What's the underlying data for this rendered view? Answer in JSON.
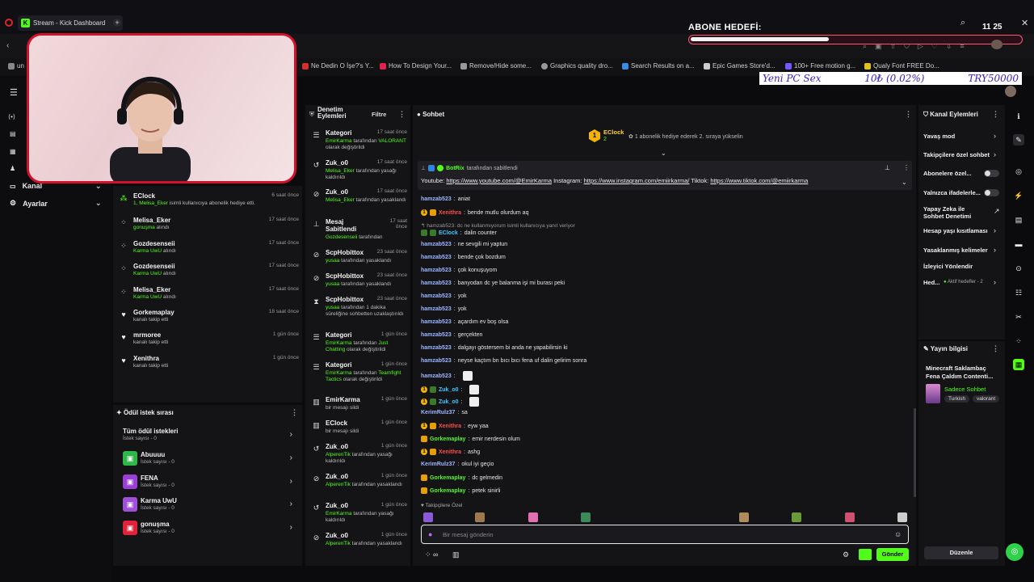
{
  "browser": {
    "tab_title": "Stream - Kick Dashboard",
    "clock": "11 25",
    "bookmarks": [
      {
        "label": "Ne Dedin O İşe?'s Y...",
        "color": "#d03030"
      },
      {
        "label": "How To Design Your...",
        "color": "#e0224f"
      },
      {
        "label": "Remove/Hide some...",
        "color": "#999999"
      },
      {
        "label": "Graphics quality dro...",
        "color": "#999999"
      },
      {
        "label": "Search Results on a...",
        "color": "#3b8be0"
      },
      {
        "label": "Epic Games Store'd...",
        "color": "#cccccc"
      },
      {
        "label": "100+ Free motion g...",
        "color": "#7755ff"
      },
      {
        "label": "Qualy Font FREE Do...",
        "color": "#e0c020"
      }
    ],
    "bookmark_first": "un"
  },
  "overlay": {
    "goal_title": "ABONE HEDEFİ:",
    "goal_progress": 0.42,
    "pc_goal_name": "Yeni PC Sex",
    "pc_goal_amount": "10₺ (0.02%)",
    "pc_goal_target": "TRY50000"
  },
  "leftnav": {
    "items": [
      {
        "label": "Kanal"
      },
      {
        "label": "Ayarlar"
      }
    ]
  },
  "events": {
    "rows": [
      {
        "name": "EClock",
        "sub_user": "1, Melisa_Eker",
        "sub_text": " isimli kullanıcıya abonelik hediye etti.",
        "time": "6 saat önce",
        "icon": "gift"
      },
      {
        "name": "Melisa_Eker",
        "sub_user": "gonuşma",
        "sub_text": " alındı",
        "time": "17 saat önce",
        "icon": "reward"
      },
      {
        "name": "Gozdesenseii",
        "sub_user": "Karma UwU",
        "sub_text": " alındı",
        "time": "17 saat önce",
        "icon": "reward"
      },
      {
        "name": "Gozdesenseii",
        "sub_user": "Karma UwU",
        "sub_text": " alındı",
        "time": "17 saat önce",
        "icon": "reward"
      },
      {
        "name": "Melisa_Eker",
        "sub_user": "Karma UwU",
        "sub_text": " alındı",
        "time": "17 saat önce",
        "icon": "reward"
      },
      {
        "name": "Gorkemaplay",
        "sub_user": "",
        "sub_text": "kanalı takip etti",
        "time": "18 saat önce",
        "icon": "heart"
      },
      {
        "name": "mrmoree",
        "sub_user": "",
        "sub_text": "kanalı takip etti",
        "time": "1 gün önce",
        "icon": "heart"
      },
      {
        "name": "Xenithra",
        "sub_user": "",
        "sub_text": "kanalı takip etti",
        "time": "1 gün önce",
        "icon": "heart"
      }
    ]
  },
  "rewards": {
    "title": "Ödül istek sırası",
    "all_title": "Tüm ödül istekleri",
    "all_sub": "İstek sayısı - 0",
    "items": [
      {
        "name": "Abuuuu",
        "sub": "İstek sayısı - 0",
        "color": "#2fb84a"
      },
      {
        "name": "FENA",
        "sub": "İstek sayısı - 0",
        "color": "#9b3fd6"
      },
      {
        "name": "Karma UwU",
        "sub": "İstek sayısı - 0",
        "color": "#a04fd8"
      },
      {
        "name": "gonuşma",
        "sub": "İstek sayısı - 0",
        "color": "#e0223a"
      }
    ]
  },
  "moderation": {
    "title": "Denetim Eylemleri",
    "filter": "Filtre",
    "rows": [
      {
        "name": "Kategori",
        "time": "17 saat önce",
        "sub_user": "EmirKarma",
        "sub_text": " tarafından ",
        "sub_extra": "VALORANT",
        "sub_tail": " olarak değiştirildi",
        "icon": "cat"
      },
      {
        "name": "Zuk_o0",
        "time": "17 saat önce",
        "sub_user": "Melisa_Eker",
        "sub_text": " tarafından yasağı kaldırıldı",
        "sub_extra": "",
        "sub_tail": "",
        "icon": "undo"
      },
      {
        "name": "Zuk_o0",
        "time": "17 saat önce",
        "sub_user": "Melisa_Eker",
        "sub_text": " tarafından yasaklandı",
        "sub_extra": "",
        "sub_tail": "",
        "icon": "ban"
      },
      {
        "name": "Mesaj Sabitlendi",
        "time": "17 saat önce",
        "sub_user": "Gozdesenseii",
        "sub_text": " tarafından",
        "sub_extra": "",
        "sub_tail": "",
        "icon": "pin"
      },
      {
        "name": "ScpHobittox",
        "time": "23 saat önce",
        "sub_user": "yusaa",
        "sub_text": " tarafından yasaklandı",
        "sub_extra": "",
        "sub_tail": "",
        "icon": "ban"
      },
      {
        "name": "ScpHobittox",
        "time": "23 saat önce",
        "sub_user": "yusaa",
        "sub_text": " tarafından yasaklandı",
        "sub_extra": "",
        "sub_tail": "",
        "icon": "ban"
      },
      {
        "name": "ScpHobittox",
        "time": "23 saat önce",
        "sub_user": "yusaa",
        "sub_text": " tarafından 1 dakika süreliğine sohbetten uzaklaştırıldı",
        "sub_extra": "",
        "sub_tail": "",
        "icon": "timer"
      },
      {
        "name": "Kategori",
        "time": "1 gün önce",
        "sub_user": "EmirKarma",
        "sub_text": " tarafından ",
        "sub_extra": "Just Chatting",
        "sub_tail": " olarak değiştirildi",
        "icon": "cat"
      },
      {
        "name": "Kategori",
        "time": "1 gün önce",
        "sub_user": "EmirKarma",
        "sub_text": " tarafından ",
        "sub_extra": "Teamfight Tactics",
        "sub_tail": " olarak değiştirildi",
        "icon": "cat"
      },
      {
        "name": "EmirKarma",
        "time": "1 gün önce",
        "sub_user": "",
        "sub_text": "bir mesajı sildi",
        "sub_extra": "",
        "sub_tail": "",
        "icon": "trash"
      },
      {
        "name": "EClock",
        "time": "1 gün önce",
        "sub_user": "",
        "sub_text": "bir mesajı sildi",
        "sub_extra": "",
        "sub_tail": "",
        "icon": "trash"
      },
      {
        "name": "Zuk_o0",
        "time": "1 gün önce",
        "sub_user": "AlperenTik",
        "sub_text": " tarafından yasağı kaldırıldı",
        "sub_extra": "",
        "sub_tail": "",
        "icon": "undo"
      },
      {
        "name": "Zuk_o0",
        "time": "1 gün önce",
        "sub_user": "AlperenTik",
        "sub_text": " tarafından yasaklandı",
        "sub_extra": "",
        "sub_tail": "",
        "icon": "ban"
      },
      {
        "name": "Zuk_o0",
        "time": "1 gün önce",
        "sub_user": "EmirKarma",
        "sub_text": " tarafından yasağı kaldırıldı",
        "sub_extra": "",
        "sub_tail": "",
        "icon": "undo"
      },
      {
        "name": "Zuk_o0",
        "time": "1 gün önce",
        "sub_user": "AlperenTik",
        "sub_text": " tarafından yasaklandı",
        "sub_extra": "",
        "sub_tail": "",
        "icon": "ban"
      }
    ]
  },
  "chat": {
    "title": "Sohbet",
    "top_user": "EClock",
    "top_level": "2",
    "top_text": "1 abonelik hediye ederek 2. sıraya yükselin",
    "pinned_by_user": "BotRix",
    "pinned_by_text": " tarafından sabitlendi",
    "pinned_prefix": "Youtube: ",
    "pinned_yt": "https://www.youtube.com/@EmirKarma",
    "pinned_ig_label": " Instagram: ",
    "pinned_ig": "https://www.instagram.com/emiirkarma/",
    "pinned_tt_label": " Tiktok: ",
    "pinned_tt": "https://www.tiktok.com/@emiirkarma",
    "reply_hint": "hamzab523: dc ne kullanmıyorum isimli kullanıcıya yanıt veriyor",
    "messages": [
      {
        "user": "hamzab523",
        "text": "aniat",
        "color": "blue",
        "badges": []
      },
      {
        "user": "Xenithra",
        "text": "bende mutlu olurdum aq",
        "color": "red",
        "badges": [
          "yel",
          "gold"
        ]
      },
      {
        "user": "EClock",
        "text": "dalin counter",
        "color": "teal",
        "badges": [
          "sh",
          "sh"
        ]
      },
      {
        "user": "hamzab523",
        "text": "ne sevgili mi yaptun",
        "color": "blue",
        "badges": []
      },
      {
        "user": "hamzab523",
        "text": "bende çok bozdum",
        "color": "blue",
        "badges": []
      },
      {
        "user": "hamzab523",
        "text": "çok konuşuyom",
        "color": "blue",
        "badges": []
      },
      {
        "user": "hamzab523",
        "text": "banyodan dc ye balanma işi mi burası peki",
        "color": "blue",
        "badges": []
      },
      {
        "user": "hamzab523",
        "text": "yok",
        "color": "blue",
        "badges": []
      },
      {
        "user": "hamzab523",
        "text": "yok",
        "color": "blue",
        "badges": []
      },
      {
        "user": "hamzab523",
        "text": "açardım ev boş olsa",
        "color": "blue",
        "badges": []
      },
      {
        "user": "hamzab523",
        "text": "gerçekten",
        "color": "blue",
        "badges": []
      },
      {
        "user": "hamzab523",
        "text": "dalgayı göstersem bi anda ne yapabilirsin ki",
        "color": "blue",
        "badges": []
      },
      {
        "user": "hamzab523",
        "text": "neyse kaçtım bn bıcı bıcı fena uf dalin gelirim sonra",
        "color": "blue",
        "badges": []
      },
      {
        "user": "hamzab523",
        "text": "",
        "color": "blue",
        "badges": []
      },
      {
        "user": "Zuk_o0",
        "text": "",
        "color": "teal",
        "badges": [
          "yel",
          "sh"
        ]
      },
      {
        "user": "Zuk_o0",
        "text": "",
        "color": "teal",
        "badges": [
          "yel",
          "sh"
        ]
      },
      {
        "user": "KerimRulz37",
        "text": "sa",
        "color": "blue",
        "badges": []
      },
      {
        "user": "Xenithra",
        "text": "eyw yaa",
        "color": "red",
        "badges": [
          "yel",
          "gold"
        ]
      },
      {
        "user": "Gorkemaplay",
        "text": "emir nerdesin olum",
        "color": "green",
        "badges": [
          "gold"
        ]
      },
      {
        "user": "Xenithra",
        "text": "ashg",
        "color": "red",
        "badges": [
          "yel",
          "gold"
        ]
      },
      {
        "user": "KerimRulz37",
        "text": "okul iyi geçio",
        "color": "blue",
        "badges": []
      },
      {
        "user": "Gorkemaplay",
        "text": "dc gelmedin",
        "color": "green",
        "badges": [
          "gold"
        ]
      },
      {
        "user": "Gorkemaplay",
        "text": "petek sinirli",
        "color": "green",
        "badges": [
          "gold"
        ]
      }
    ],
    "followers_label": "Takipçilere Özel",
    "input_placeholder": "Bir mesaj gönderin",
    "send_label": "Gönder"
  },
  "channel_actions": {
    "title": "Kanal Eylemleri",
    "items": [
      {
        "label": "Yavaş mod",
        "control": "chevron"
      },
      {
        "label": "Takipçilere özel sohbet",
        "control": "chevron"
      },
      {
        "label": "Abonelere özel...",
        "control": "toggle"
      },
      {
        "label": "Yalnızca ifadelerle...",
        "control": "toggle"
      },
      {
        "label": "Yapay Zeka ile Sohbet Denetimi",
        "control": "ext"
      },
      {
        "label": "Hesap yaşı kısıtlaması",
        "control": "chevron"
      },
      {
        "label": "Yasaklanmış kelimeler",
        "control": "chevron"
      },
      {
        "label": "İzleyici Yönlendir",
        "control": "none"
      },
      {
        "label": "Hed...",
        "control": "chevron"
      }
    ],
    "goal_status": "Aktif hedefler - 2"
  },
  "stream_info": {
    "title": "Yayın bilgisi",
    "stream_title": "Minecraft Saklambaç Fena Çaldım Contenti...",
    "category": "Sadece Sohbet",
    "tags": [
      "Turkish",
      "valorant"
    ],
    "edit_label": "Düzenle"
  }
}
